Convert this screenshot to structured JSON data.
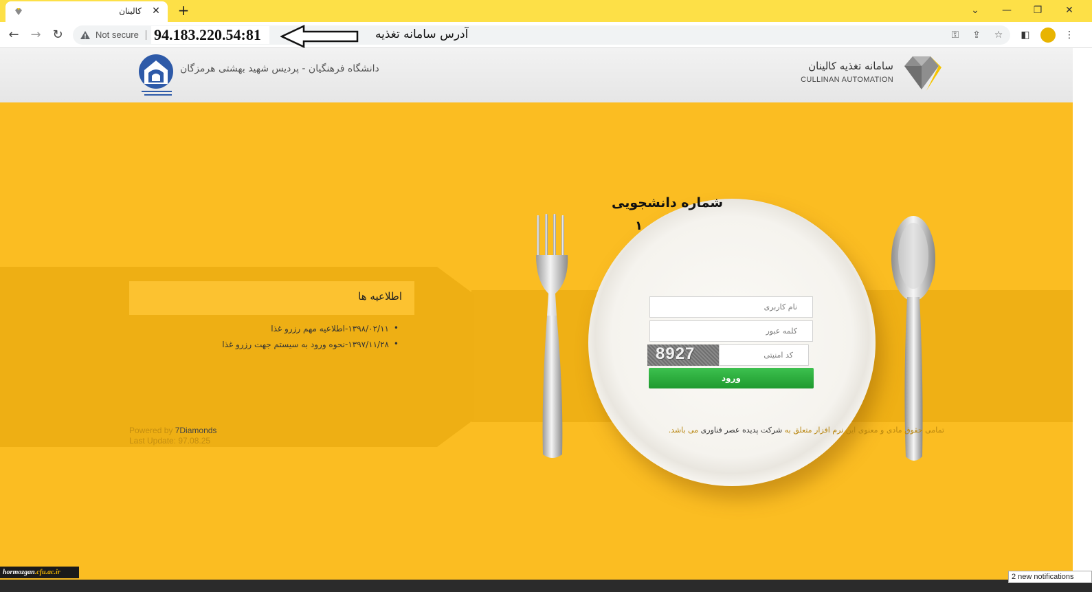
{
  "browser": {
    "tab_title": "کالینان",
    "url": "94.183.220.54:81",
    "security_label": "Not secure",
    "address_annotation": "آدرس سامانه تغذیه"
  },
  "header": {
    "brand_title": "سامانه تغذیه کالینان",
    "brand_subtitle": "CULLINAN AUTOMATION",
    "university_name": "دانشگاه فرهنگیان - پردیس شهید بهشتی هرمزگان"
  },
  "news": {
    "heading": "اطلاعیه ها",
    "items": [
      "۱۳۹۸/۰۲/۱۱-اطلاعیه مهم رزرو غذا",
      "۱۳۹۷/۱۱/۲۸-نحوه ورود به سیستم جهت رزرو غذا"
    ]
  },
  "login": {
    "username_placeholder": "نام کاربری",
    "password_placeholder": "کلمه عبور",
    "captcha_placeholder": "کد امنیتی",
    "captcha_code": "8927",
    "submit_label": "ورود",
    "annotation_username": "شماره دانشجویی",
    "annotation_password": "۱"
  },
  "footer": {
    "powered_prefix": "Powered by",
    "powered_brand": "7Diamonds",
    "last_update": "Last Update: 97.08.25",
    "rights_prefix": "تمامی حقوق مادی و معنوی این نرم افزار متعلق به",
    "rights_company": "شرکت پدیده عصر فناوری",
    "rights_suffix": "می باشد."
  },
  "overlay": {
    "watermark_main": "hormozgan",
    "watermark_domain": ".cfu.ac.ir",
    "notification": "2 new notifications"
  },
  "colors": {
    "chrome_yellow": "#fde047",
    "page_yellow": "#fbbd22",
    "login_green": "#1f9a2e"
  }
}
